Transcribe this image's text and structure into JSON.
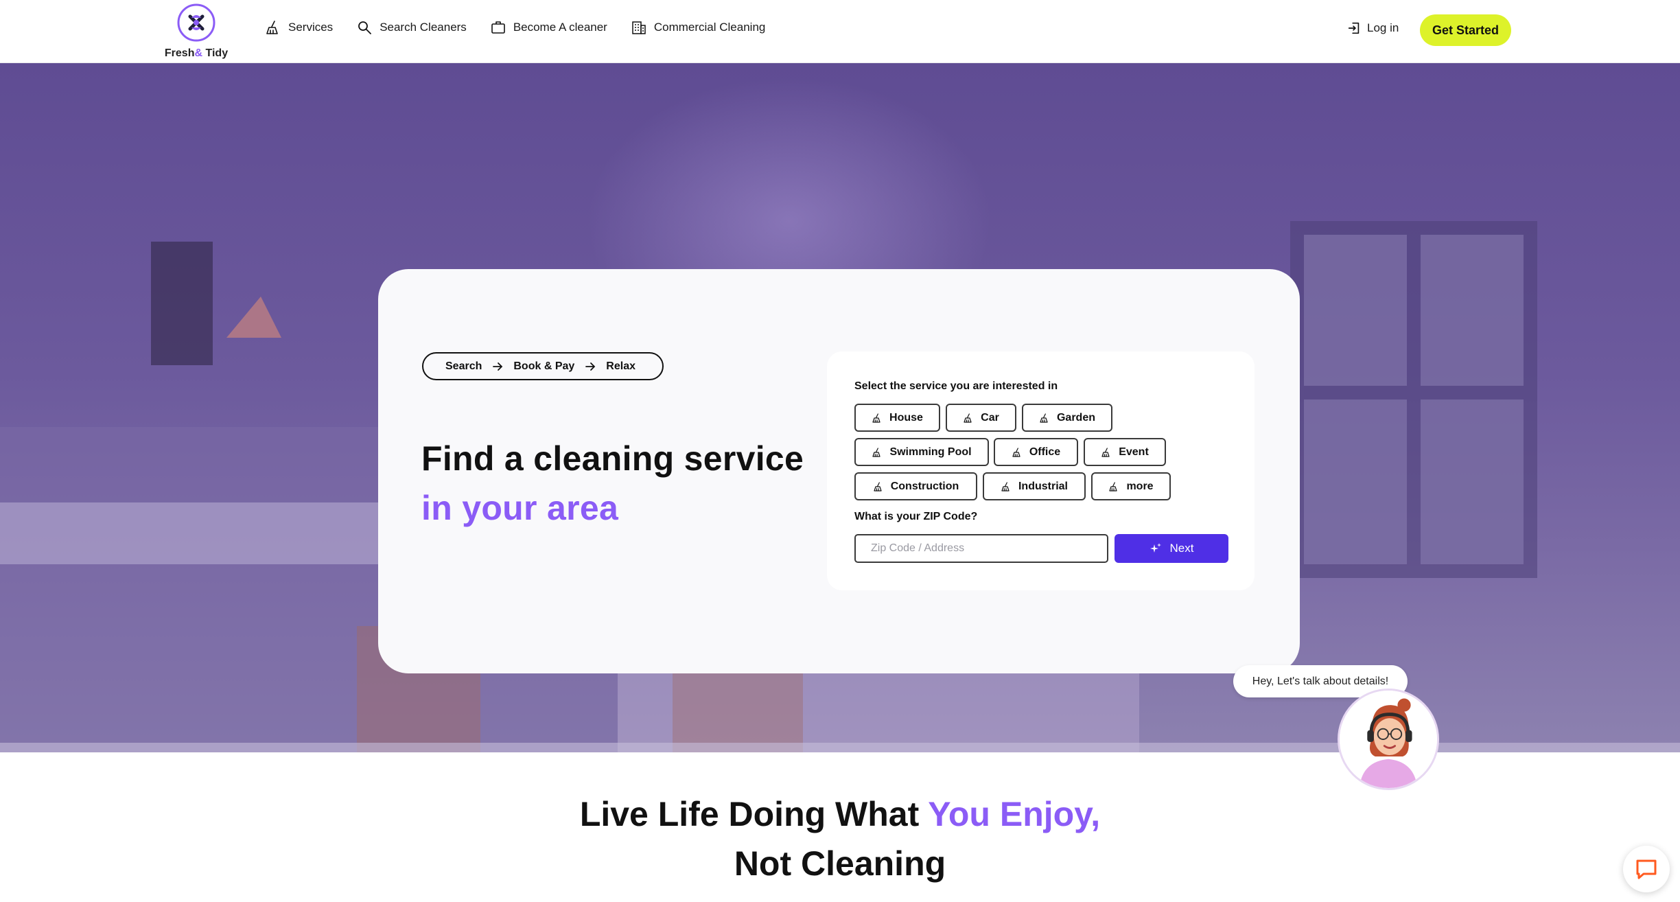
{
  "brand": {
    "name_part1": "Fresh",
    "name_amp": "&",
    "name_part2": "Tidy",
    "accent_color": "#8b5cf6",
    "cta_color": "#ddf22a",
    "primary_button_color": "#4f2fe6"
  },
  "nav": {
    "items": [
      {
        "label": "Services",
        "icon": "broom-icon"
      },
      {
        "label": "Search Cleaners",
        "icon": "search-icon"
      },
      {
        "label": "Become A cleaner",
        "icon": "briefcase-icon"
      },
      {
        "label": "Commercial Cleaning",
        "icon": "building-icon"
      }
    ],
    "login_label": "Log in",
    "get_started_label": "Get Started"
  },
  "hero": {
    "steps": [
      "Search",
      "Book & Pay",
      "Relax"
    ],
    "headline_line1": "Find a cleaning service",
    "headline_line2": "in your area",
    "service_prompt": "Select the service you are interested in",
    "services": [
      "House",
      "Car",
      "Garden",
      "Swimming Pool",
      "Office",
      "Event",
      "Construction",
      "Industrial",
      "more"
    ],
    "zip_prompt": "What is your ZIP Code?",
    "zip_placeholder": "Zip Code / Address",
    "zip_value": "",
    "next_label": "Next"
  },
  "chat": {
    "bubble_text": "Hey, Let's talk about details!"
  },
  "section": {
    "tagline_part1": "Live Life Doing What ",
    "tagline_accent": "You Enjoy,",
    "tagline_line2": "Not Cleaning"
  }
}
